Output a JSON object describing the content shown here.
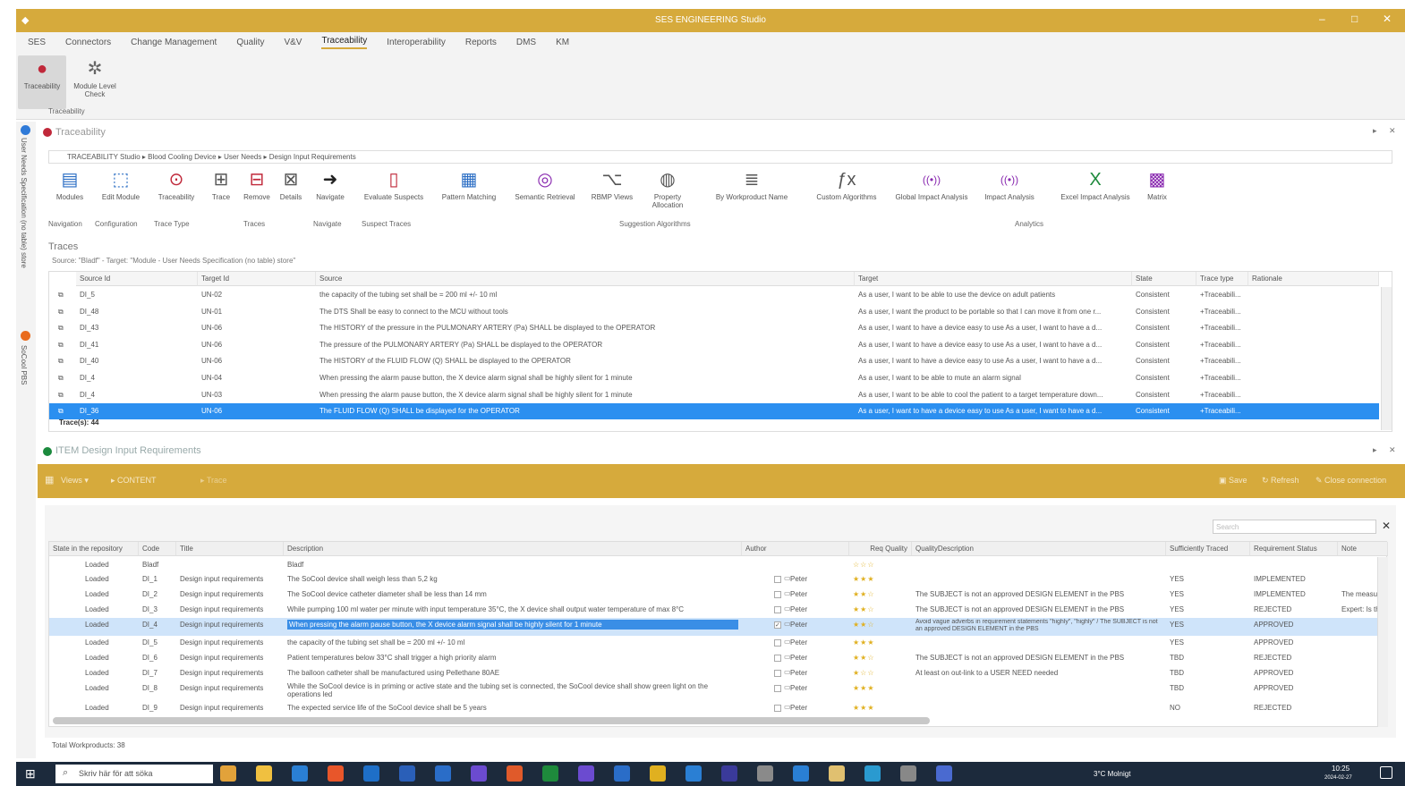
{
  "app": {
    "title": "SES ENGINEERING Studio"
  },
  "menu": [
    "SES",
    "Connectors",
    "Change Management",
    "Quality",
    "V&V",
    "Traceability",
    "Interoperability",
    "Reports",
    "DMS",
    "KM"
  ],
  "menu_active": "Traceability",
  "ribbon": {
    "traceability": "Traceability",
    "module_level_check": "Module Level Check",
    "group": "Traceability"
  },
  "left_tabs": [
    "User Needs Specification (no table) store",
    "SoCool PBS"
  ],
  "trace_panel": {
    "title": "Traceability",
    "breadcrumb": "TRACEABILITY Studio  ▸  Blood Cooling Device  ▸  User Needs  ▸  Design Input Requirements",
    "tools": [
      {
        "label": "Modules",
        "icon": "modules-icon"
      },
      {
        "label": "Edit Module",
        "icon": "edit-module-icon"
      },
      {
        "label": "Traceability",
        "icon": "traceability-icon"
      },
      {
        "label": "Trace",
        "icon": "trace-icon"
      },
      {
        "label": "Remove",
        "icon": "remove-icon"
      },
      {
        "label": "Details",
        "icon": "details-icon"
      },
      {
        "label": "Navigate",
        "icon": "navigate-icon"
      },
      {
        "label": "Evaluate Suspects",
        "icon": "evaluate-icon"
      },
      {
        "label": "Pattern Matching",
        "icon": "pattern-icon"
      },
      {
        "label": "Semantic Retrieval",
        "icon": "semantic-icon"
      },
      {
        "label": "RBMP Views",
        "icon": "views-icon"
      },
      {
        "label": "Property Allocation",
        "icon": "property-icon"
      },
      {
        "label": "By Workproduct Name",
        "icon": "workproduct-icon"
      },
      {
        "label": "Custom Algorithms",
        "icon": "function-icon"
      },
      {
        "label": "Global Impact Analysis",
        "icon": "global-impact-icon"
      },
      {
        "label": "Impact Analysis",
        "icon": "impact-icon"
      },
      {
        "label": "Excel Impact Analysis",
        "icon": "excel-icon"
      },
      {
        "label": "Matrix",
        "icon": "matrix-icon"
      }
    ],
    "groups": [
      "Navigation",
      "Configuration",
      "Trace Type",
      "Traces",
      "Navigate",
      "Suspect Traces",
      "Suggestion Algorithms",
      "Analytics"
    ],
    "traces_label": "Traces",
    "source_line": "Source: \"Bladf\" - Target: \"Module - User Needs Specification (no table) store\"",
    "columns": [
      "Source Id",
      "Target Id",
      "Source",
      "Target",
      "State",
      "Trace type",
      "Rationale"
    ],
    "rows": [
      [
        "DI_5",
        "UN-02",
        "the capacity of the tubing set shall be = 200 ml +/- 10 ml",
        "As a user, I want to be able to use the device on adult patients",
        "Consistent",
        "+Traceabili..."
      ],
      [
        "DI_48",
        "UN-01",
        "The DTS Shall be easy to connect to the MCU without tools",
        "As a user, I want the product to be portable so that I can move it from one r...",
        "Consistent",
        "+Traceabili..."
      ],
      [
        "DI_43",
        "UN-06",
        "The HISTORY of the pressure in the PULMONARY ARTERY (Pa) SHALL be displayed to the OPERATOR",
        "As a user, I want to have a device easy to use As a user, I want to have a d...",
        "Consistent",
        "+Traceabili..."
      ],
      [
        "DI_41",
        "UN-06",
        "The pressure of the PULMONARY ARTERY (Pa) SHALL be displayed to the OPERATOR",
        "As a user, I want to have a device easy to use As a user, I want to have a d...",
        "Consistent",
        "+Traceabili..."
      ],
      [
        "DI_40",
        "UN-06",
        "The HISTORY of the FLUID FLOW (Q) SHALL be displayed to the OPERATOR",
        "As a user, I want to have a device easy to use As a user, I want to have a d...",
        "Consistent",
        "+Traceabili..."
      ],
      [
        "DI_4",
        "UN-04",
        "When pressing the alarm pause button, the X device alarm signal shall be highly silent for 1 minute",
        "As a user, I want to be able to mute an alarm signal",
        "Consistent",
        "+Traceabili..."
      ],
      [
        "DI_4",
        "UN-03",
        "When pressing the alarm pause button, the X device alarm signal shall be highly silent for 1 minute",
        "As a user, I want to be able to cool the patient to a target temperature down...",
        "Consistent",
        "+Traceabili..."
      ],
      [
        "DI_36",
        "UN-06",
        "The FLUID FLOW (Q) SHALL be displayed for the OPERATOR",
        "As a user, I want to have a device easy to use As a user, I want to have a d...",
        "Consistent",
        "+Traceabili..."
      ]
    ],
    "trace_count": "Trace(s): 44"
  },
  "di_panel": {
    "title": "ITEM Design Input Requirements",
    "views": "Views",
    "content": "CONTENT",
    "trace": "Trace",
    "save": "Save",
    "refresh": "Refresh",
    "close": "Close connection",
    "search_placeholder": "Search",
    "columns": [
      "State in the repository",
      "Code",
      "Title",
      "Description",
      "Author",
      "Req Quality",
      "QualityDescription",
      "Sufficiently Traced",
      "Requirement Status",
      "Note"
    ],
    "rows": [
      [
        "Loaded",
        "Bladf",
        "",
        "Bladf",
        "",
        "☆☆☆",
        "",
        "",
        "",
        ""
      ],
      [
        "Loaded",
        "DI_1",
        "Design input requirements",
        "The SoCool device shall weigh less than 5,2 kg",
        "Peter",
        "★★★",
        "",
        "YES",
        "IMPLEMENTED",
        ""
      ],
      [
        "Loaded",
        "DI_2",
        "Design input requirements",
        "The SoCool device catheter diameter shall be less than 14 mm",
        "Peter",
        "★★☆",
        "The SUBJECT is not an approved DESIGN ELEMENT in the PBS",
        "YES",
        "IMPLEMENTED",
        "The measure"
      ],
      [
        "Loaded",
        "DI_3",
        "Design input requirements",
        "While pumping 100 ml water per minute with input temperature 35°C, the X device shall output water temperature of max 8°C",
        "Peter",
        "★★☆",
        "The SUBJECT is not an approved DESIGN ELEMENT in the PBS",
        "YES",
        "REJECTED",
        "Expert: Is th"
      ],
      [
        "Loaded",
        "DI_4",
        "Design input requirements",
        "When pressing the alarm pause button, the X device alarm signal shall be highly silent for 1 minute",
        "Peter",
        "★★☆",
        "Avoid vague adverbs in requirement statements \"highly\", \"highly\" / The SUBJECT is not an approved DESIGN ELEMENT in the PBS",
        "YES",
        "APPROVED",
        ""
      ],
      [
        "Loaded",
        "DI_5",
        "Design input requirements",
        "the capacity of the tubing set shall be = 200 ml +/- 10 ml",
        "Peter",
        "★★★",
        "",
        "YES",
        "APPROVED",
        ""
      ],
      [
        "Loaded",
        "DI_6",
        "Design input requirements",
        "Patient temperatures below 33°C shall trigger a high priority alarm",
        "Peter",
        "★★☆",
        "The SUBJECT is not an approved DESIGN ELEMENT in the PBS",
        "TBD",
        "REJECTED",
        ""
      ],
      [
        "Loaded",
        "DI_7",
        "Design input requirements",
        "The balloon catheter shall be manufactured using Pellethane 80AE",
        "Peter",
        "★☆☆",
        "At least on out-link to a USER NEED needed",
        "TBD",
        "APPROVED",
        ""
      ],
      [
        "Loaded",
        "DI_8",
        "Design input requirements",
        "While the SoCool device is in priming or active state and the tubing set is connected, the SoCool device shall show green light on the operations led",
        "Peter",
        "★★★",
        "",
        "TBD",
        "APPROVED",
        ""
      ],
      [
        "Loaded",
        "DI_9",
        "Design input requirements",
        "The expected service life of the SoCool device shall be 5 years",
        "Peter",
        "★★★",
        "",
        "NO",
        "REJECTED",
        ""
      ]
    ],
    "footer": "Total Workproducts: 38"
  },
  "taskbar": {
    "search": "Skriv här för att söka",
    "weather": "3°C Molnigt",
    "time": "10:25",
    "date": "2024-02-27"
  }
}
